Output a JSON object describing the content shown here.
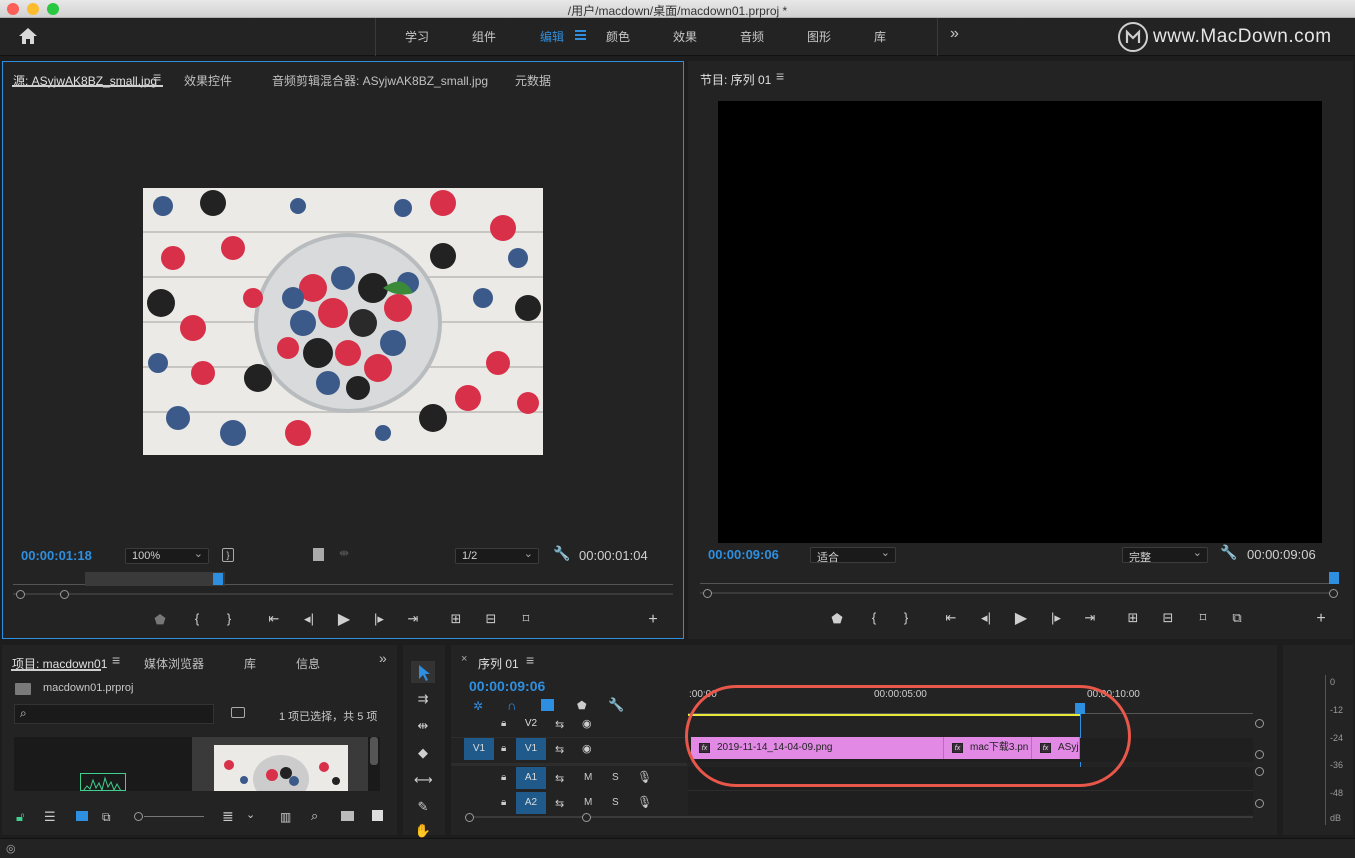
{
  "window": {
    "title": "/用户/macdown/桌面/macdown01.prproj *",
    "watermark": "www.MacDown.com"
  },
  "workspaces": {
    "items": [
      "学习",
      "组件",
      "编辑",
      "颜色",
      "效果",
      "音频",
      "图形",
      "库"
    ],
    "active": "编辑",
    "overflow": "»"
  },
  "source_panel": {
    "tabs": [
      "源: ASyjwAK8BZ_small.jpg",
      "效果控件",
      "音频剪辑混合器: ASyjwAK8BZ_small.jpg",
      "元数据"
    ],
    "timecode_current": "00:00:01:18",
    "zoom": "100%",
    "resolution": "1/2",
    "timecode_duration": "00:00:01:04"
  },
  "program_panel": {
    "title": "节目: 序列 01",
    "timecode_current": "00:00:09:06",
    "fit": "适合",
    "quality": "完整",
    "timecode_duration": "00:00:09:06"
  },
  "project_panel": {
    "tabs": [
      "项目: macdown01",
      "媒体浏览器",
      "库",
      "信息"
    ],
    "filename": "macdown01.prproj",
    "selection_status": "1 项已选择，共 5 项",
    "search_placeholder": ""
  },
  "timeline": {
    "tab": "序列 01",
    "timecode": "00:00:09:06",
    "ruler_labels": [
      ":00:00",
      "00:00:05:00",
      "00:00:10:00"
    ],
    "tracks": {
      "v2": {
        "label": "V2"
      },
      "v1": {
        "source_label": "V1",
        "label": "V1"
      },
      "a1": {
        "label": "A1",
        "m": "M",
        "s": "S"
      },
      "a2": {
        "label": "A2",
        "m": "M",
        "s": "S"
      }
    },
    "clips": [
      {
        "name": "2019-11-14_14-04-09.png"
      },
      {
        "name": "mac下载3.pn"
      },
      {
        "name": "ASyj"
      }
    ],
    "fx_label": "fx"
  },
  "audio_meter": {
    "labels": [
      "0",
      "-12",
      "-24",
      "-36",
      "-48",
      "dB"
    ]
  },
  "colors": {
    "accent": "#2e8fe0",
    "clip": "#e189e4",
    "annotation": "#e9574a",
    "work_area": "#e8e83a"
  }
}
